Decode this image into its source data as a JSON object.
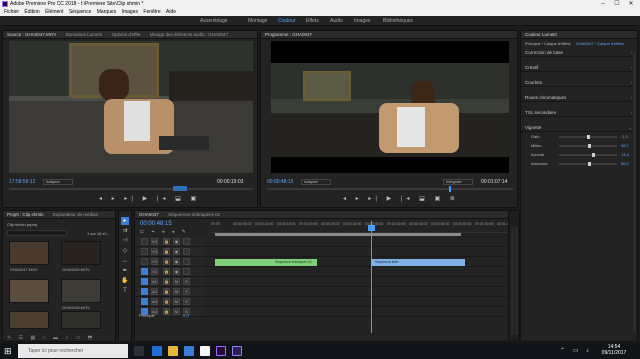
{
  "window": {
    "title": "Adobe Premiere Pro CC 2018 - I:\\Premiere Site\\Clip shmin *",
    "min": "–",
    "max": "☐",
    "close": "✕"
  },
  "menu": [
    "Fichier",
    "Édition",
    "Élément",
    "Séquence",
    "Marques",
    "Images",
    "Fenêtre",
    "Aide"
  ],
  "workspaces": [
    "Assemblage",
    "Montage",
    "Couleur",
    "Effets",
    "Audio",
    "Images",
    "Bibliothèques"
  ],
  "active_workspace": "Couleur",
  "source": {
    "tabs": [
      "Source : GHA0047.MOV",
      "Domaines Lumetri",
      "Options d'effet",
      "Mixage des éléments audio : GHA0047"
    ],
    "timecode": "17:58:59:12",
    "fit": "Adapter",
    "duration": "00:00:19:03"
  },
  "program": {
    "tabs": [
      "Programme : GHA0047"
    ],
    "timecode": "00:00:48:15",
    "fit": "Adapter",
    "quality": "Intégrale",
    "duration": "00:01:07:14"
  },
  "lumetri": {
    "title": "Couleur Lumetri",
    "clip": "Principal * Calque d'effets",
    "seq": "GHA0047 * Calque d'effets",
    "sections": [
      "Correction de base",
      "Créatif",
      "Courbes",
      "Roues chromatiques",
      "TSL secondaire",
      "Vignette"
    ],
    "vignette": [
      {
        "label": "Gain",
        "value": "-1,0"
      },
      {
        "label": "Milieu",
        "value": "49,7"
      },
      {
        "label": "Arrondi",
        "value": "14,4"
      },
      {
        "label": "Adoucies",
        "value": "50,0"
      }
    ]
  },
  "project": {
    "tabs": [
      "Projet : Clip shmin",
      "Explorateur de médias"
    ],
    "file": "Clip shmin.prproj",
    "count": "1 sur 16 él...",
    "search_placeholder": "",
    "items": [
      "GHA0047.MOV",
      "GHA0045.MOV",
      "",
      "GHA0048.MOV",
      "",
      ""
    ]
  },
  "timeline": {
    "tab": "GHA0047",
    "tab2": "Séquences imbriquées 01",
    "timecode": "00:00:48:15",
    "ruler": [
      "00:00",
      "00:00:05:00",
      "00:00:10:00",
      "00:00:15:00",
      "00:00:20:00",
      "00:00:25:00",
      "00:00:30:00",
      "00:00:35:00",
      "00:00:40:00",
      "00:00:45:00",
      "00:00:50:00",
      "00:00:55:00",
      "00:01:00:00",
      "00:01:05:00"
    ],
    "tracks_v": [
      "V4",
      "V3",
      "V2",
      "V1"
    ],
    "tracks_a": [
      "A1",
      "A2",
      "A3",
      "A4"
    ],
    "master": "Principal",
    "master_val": "0,0",
    "clip1": "Séquence imbriquée 01",
    "clip2": "Séquence imbr"
  },
  "taskbar": {
    "search_placeholder": "Taper ici pour rechercher",
    "time": "14:54",
    "date": "09/11/2017"
  },
  "colors": {
    "accent": "#4aa3ff",
    "clip_green": "#7fcf7a",
    "clip_blue": "#7fb0e6"
  }
}
